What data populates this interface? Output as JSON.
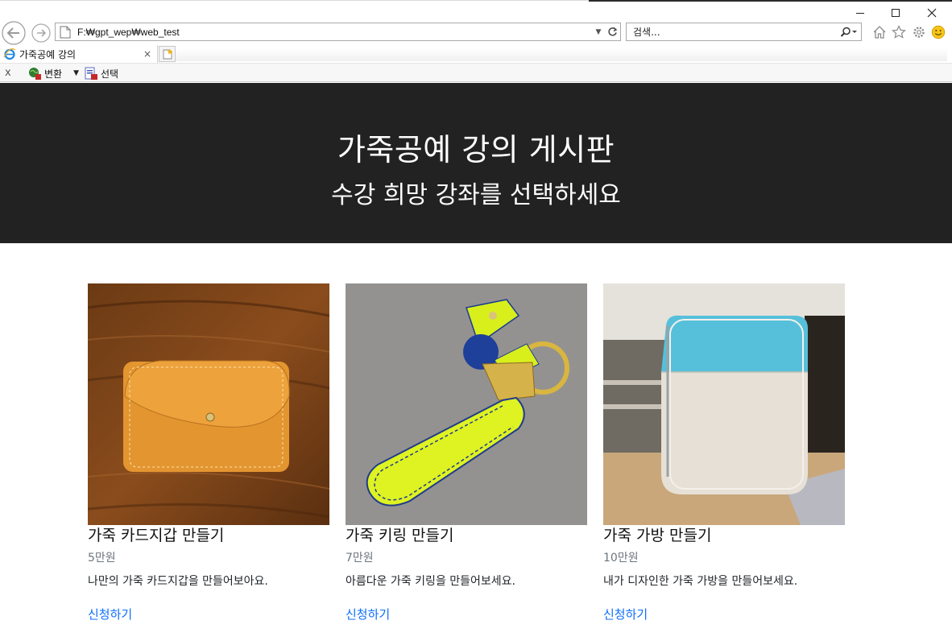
{
  "browser": {
    "address": "F:₩gpt_wep₩web_test",
    "search_placeholder": "검색...",
    "tab_title": "가죽공예 강의",
    "tab_close": "×",
    "cmd_close": "x",
    "cmd_convert": "변환",
    "cmd_select": "선택"
  },
  "hero": {
    "title": "가죽공예 강의 게시판",
    "subtitle": "수강 희망 강좌를 선택하세요"
  },
  "courses": [
    {
      "title": "가죽 카드지갑 만들기",
      "price": "5만원",
      "description": "나만의 가죽 카드지갑을 만들어보아요.",
      "action": "신청하기"
    },
    {
      "title": "가죽 키링 만들기",
      "price": "7만원",
      "description": "아름다운 가죽 키링을 만들어보세요.",
      "action": "신청하기"
    },
    {
      "title": "가죽 가방 만들기",
      "price": "10만원",
      "description": "내가 디자인한 가죽 가방을 만들어보세요.",
      "action": "신청하기"
    }
  ],
  "colors": {
    "hero_bg": "#222222",
    "link": "#0d6efd",
    "muted": "#6c757d"
  }
}
